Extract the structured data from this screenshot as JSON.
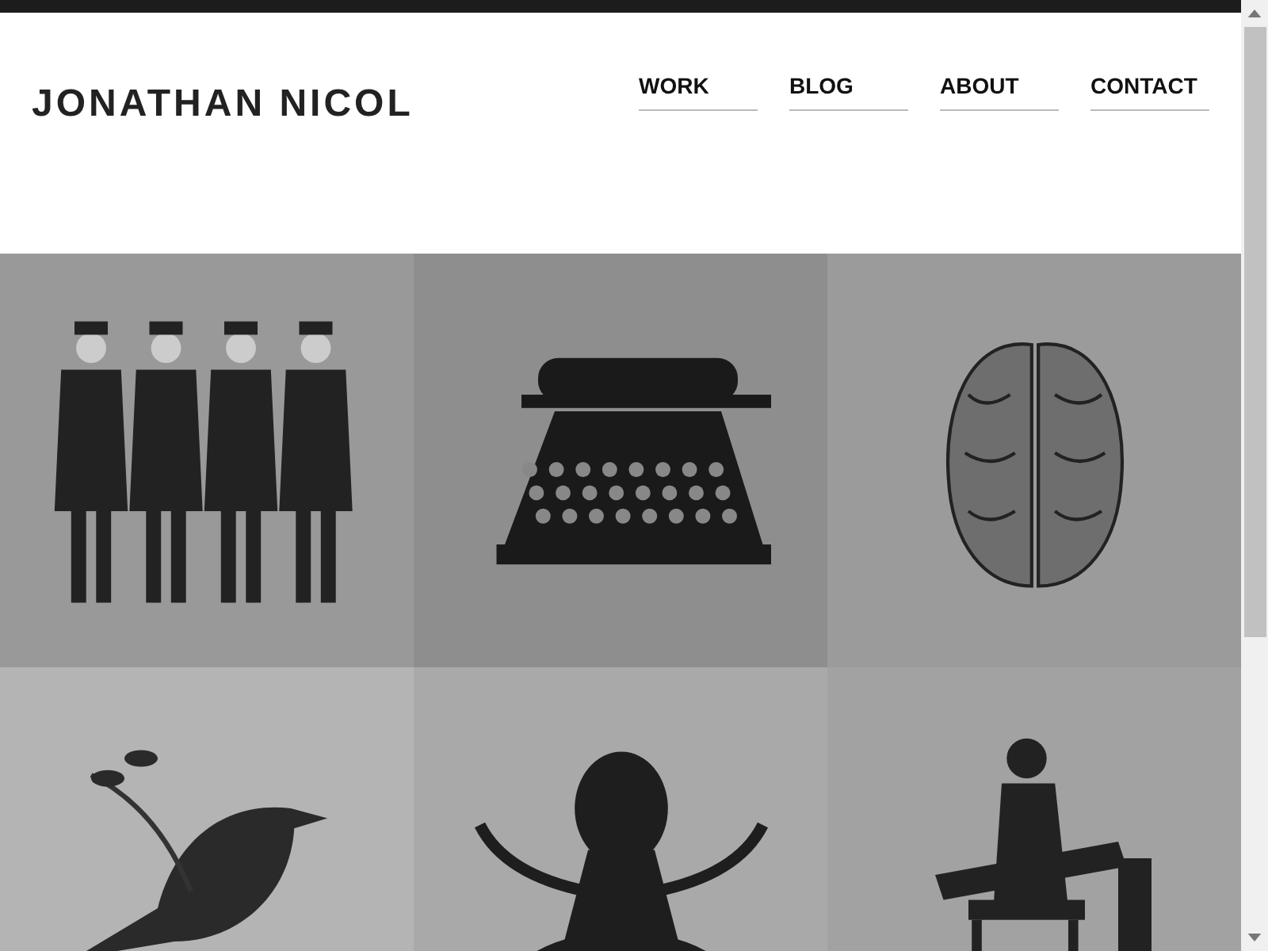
{
  "site_title": "JONATHAN NICOL",
  "nav": [
    {
      "label": "WORK"
    },
    {
      "label": "BLOG"
    },
    {
      "label": "ABOUT"
    },
    {
      "label": "CONTACT"
    }
  ],
  "tiles": [
    {
      "kind": "people"
    },
    {
      "kind": "typewriter"
    },
    {
      "kind": "brain"
    },
    {
      "kind": "bird"
    },
    {
      "kind": "octopus"
    },
    {
      "kind": "boy"
    }
  ]
}
